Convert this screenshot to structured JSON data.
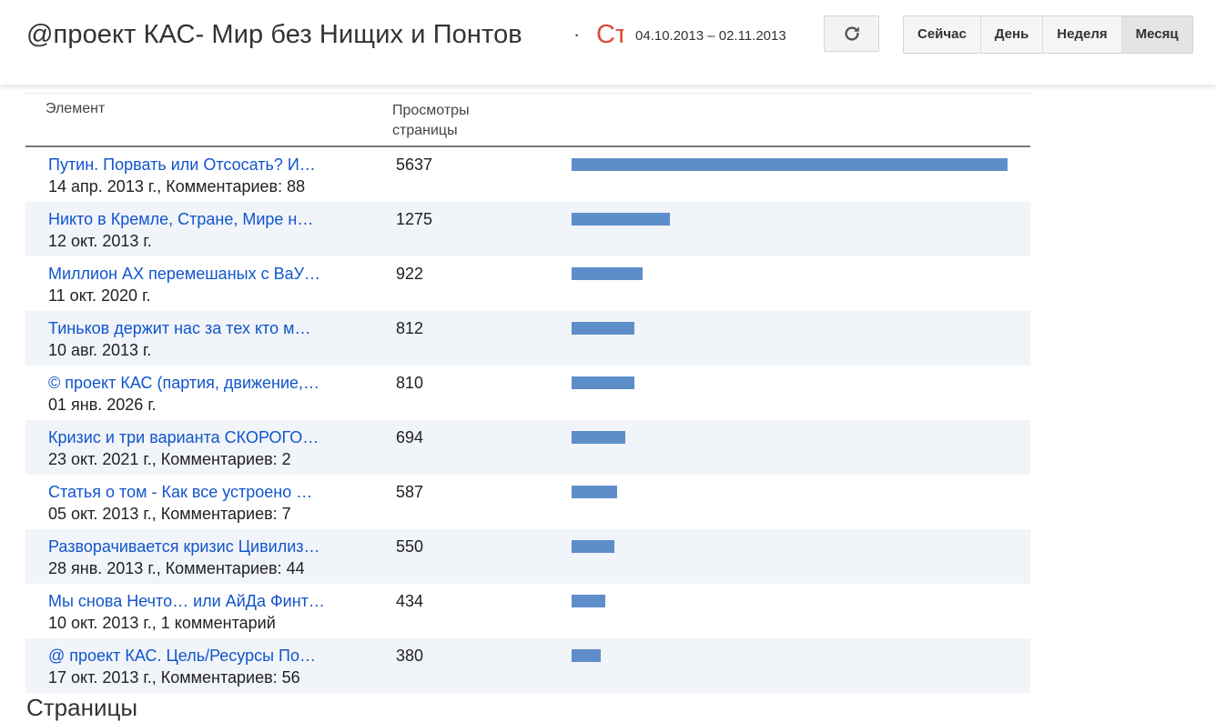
{
  "header": {
    "blog_title": "@проект КАС- Мир без Нищих и Понтов",
    "separator": "·",
    "section_title": "Статистика",
    "date_range": "04.10.2013 – 02.11.2013",
    "refresh_icon": "refresh-icon",
    "ranges": [
      "Сейчас",
      "День",
      "Неделя",
      "Месяц"
    ],
    "selected_range": "Месяц"
  },
  "table": {
    "col_element": "Элемент",
    "col_views": "Просмотры страницы",
    "bar_color": "#5e8ec9",
    "max_views": 5637,
    "rows": [
      {
        "title": "Путин. Порвать или Отсосать? И…",
        "meta": "14 апр. 2013 г., Комментариев: 88",
        "views": 5637
      },
      {
        "title": "Никто в Кремле, Стране, Мире н…",
        "meta": "12 окт. 2013 г.",
        "views": 1275
      },
      {
        "title": "Миллион АХ перемешаных с ВаУ…",
        "meta": "11 окт. 2020 г.",
        "views": 922
      },
      {
        "title": "Тиньков держит нас за тех кто м…",
        "meta": "10 авг. 2013 г.",
        "views": 812
      },
      {
        "title": "© проект КАС (партия, движение,…",
        "meta": "01 янв. 2026 г.",
        "views": 810
      },
      {
        "title": "Кризис и три варианта СКОРОГО…",
        "meta": "23 окт. 2021 г., Комментариев: 2",
        "views": 694
      },
      {
        "title": "Статья о том - Как все устроено …",
        "meta": "05 окт. 2013 г., Комментариев: 7",
        "views": 587
      },
      {
        "title": "Разворачивается кризис Цивилиз…",
        "meta": "28 янв. 2013 г., Комментариев: 44",
        "views": 550
      },
      {
        "title": "Мы снова Нечто… или АйДа Финт…",
        "meta": "10 окт. 2013 г., 1 комментарий",
        "views": 434
      },
      {
        "title": "@ проект КАС. Цель/Ресурсы По…",
        "meta": "17 окт. 2013 г., Комментариев: 56",
        "views": 380
      }
    ]
  },
  "footer_heading": "Страницы"
}
